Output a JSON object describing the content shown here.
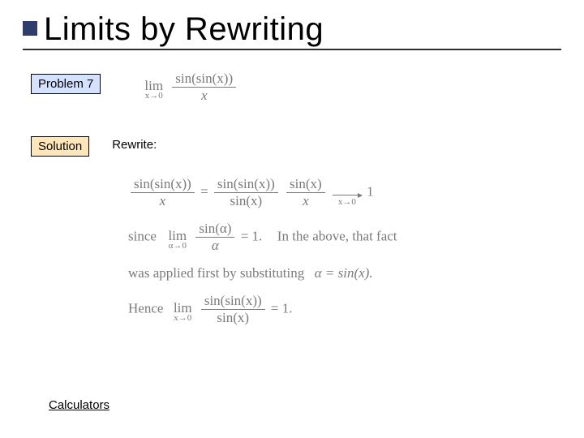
{
  "title": "Limits by Rewriting",
  "labels": {
    "problem": "Problem 7",
    "solution": "Solution",
    "rewrite": "Rewrite:",
    "calculators": "Calculators"
  },
  "mathstr": {
    "lim": "lim",
    "x_to_0": "x→0",
    "alpha_to_0": "α→0",
    "sin_sin_x": "sin(sin(x))",
    "x": "x",
    "eq": "=",
    "sin_x": "sin(x)",
    "sin_alpha": "sin(α)",
    "alpha": "α",
    "one": "1",
    "since": "since",
    "eq1dot": "= 1.",
    "in_above": "In the above, that fact",
    "was_applied": "was applied first by substituting",
    "alpha_eq_sinx": "α = sin(x).",
    "hence": "Hence"
  },
  "chart_data": {
    "type": "table",
    "title": "Limit evaluation by rewriting",
    "expressions": [
      "lim_{x→0} sin(sin(x)) / x",
      "sin(sin(x))/x = (sin(sin(x))/sin(x)) * (sin(x)/x) → 1 as x→0",
      "since lim_{α→0} sin(α)/α = 1",
      "substitution: α = sin(x)",
      "Hence lim_{x→0} sin(sin(x))/sin(x) = 1"
    ]
  }
}
